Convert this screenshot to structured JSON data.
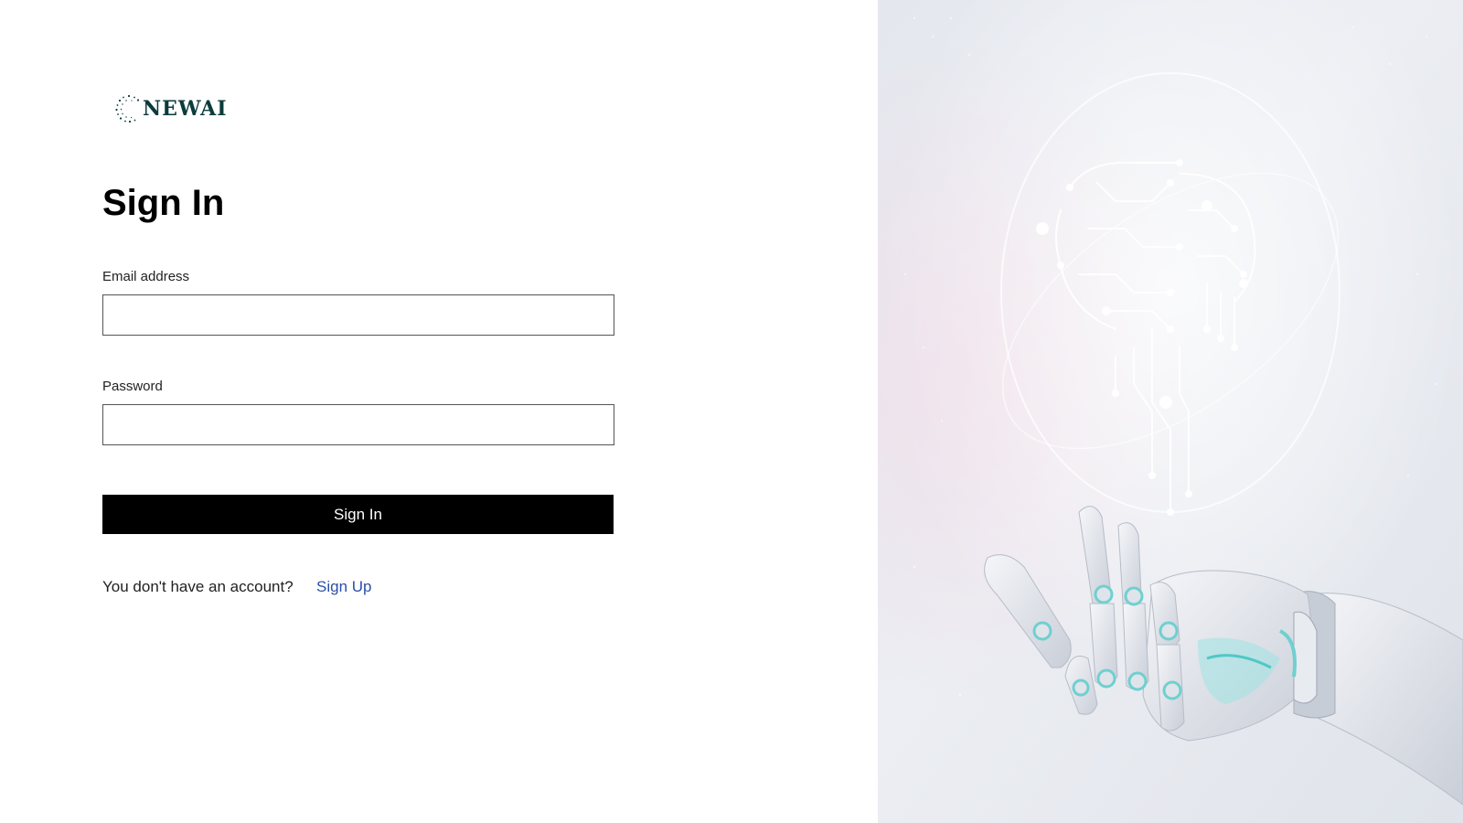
{
  "brand": {
    "name": "NEWAI",
    "text_color": "#0c3b3d"
  },
  "form": {
    "title": "Sign In",
    "email_label": "Email address",
    "email_value": "",
    "password_label": "Password",
    "password_value": "",
    "submit_label": "Sign In",
    "submit_color": "#000000"
  },
  "footer": {
    "prompt": "You don't have an account?",
    "signup_label": "Sign Up",
    "link_color": "#2a4fa8"
  },
  "hero": {
    "description_icon": "robot-hand-circuit-brain-image"
  }
}
